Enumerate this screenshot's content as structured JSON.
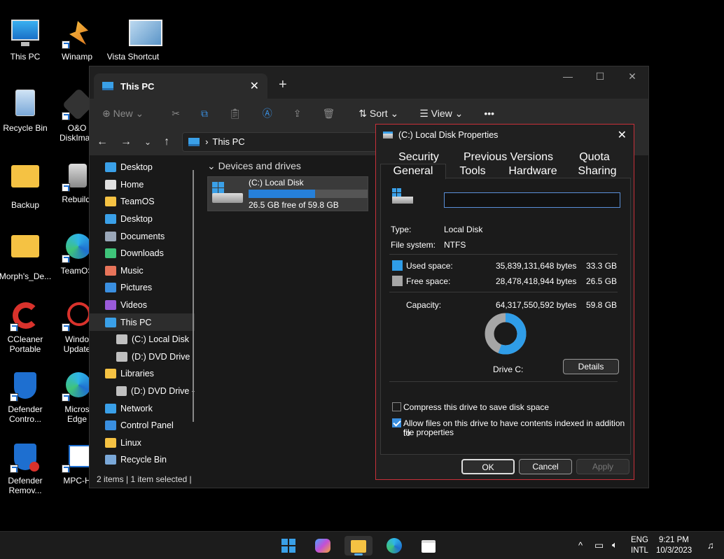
{
  "desktop": {
    "icons": [
      {
        "label": "This PC"
      },
      {
        "label": "Winamp"
      },
      {
        "label": "Vista Shortcut"
      },
      {
        "label": "Recycle Bin"
      },
      {
        "label": "O&O"
      },
      {
        "label": "DiskImag"
      },
      {
        "label": "Backup"
      },
      {
        "label": "Rebuildl"
      },
      {
        "label": "Morph's_De..."
      },
      {
        "label": "TeamOS"
      },
      {
        "label": "CCleaner"
      },
      {
        "label": "Portable"
      },
      {
        "label": "Windo"
      },
      {
        "label": "Update"
      },
      {
        "label": "Defender"
      },
      {
        "label": "Contro..."
      },
      {
        "label": "Micros"
      },
      {
        "label": "Edge"
      },
      {
        "label": "Defender"
      },
      {
        "label": "Remov..."
      },
      {
        "label": "MPC-H"
      }
    ]
  },
  "explorer": {
    "tab_title": "This PC",
    "tab_close": "✕",
    "new_tab": "+",
    "window_controls": {
      "minimize": "—",
      "maximize": "☐",
      "close": "✕"
    },
    "toolbar": {
      "new": "⊕  New ⌄",
      "sort": "⇅  Sort ⌄",
      "view": "☰  View ⌄",
      "more": "•••"
    },
    "nav": {
      "back": "←",
      "forward": "→",
      "recent": "⌄",
      "up": "↑"
    },
    "address": {
      "separator": "›",
      "path": "This PC"
    },
    "sidebar": [
      {
        "label": "Desktop",
        "color": "#3aa0e8"
      },
      {
        "label": "Home",
        "color": "#e0e0e0"
      },
      {
        "label": "TeamOS",
        "color": "#f5c243"
      },
      {
        "label": "Desktop",
        "color": "#3aa0e8"
      },
      {
        "label": "Documents",
        "color": "#9aa7b8"
      },
      {
        "label": "Downloads",
        "color": "#3fc47a"
      },
      {
        "label": "Music",
        "color": "#e8745a"
      },
      {
        "label": "Pictures",
        "color": "#3a8fe0"
      },
      {
        "label": "Videos",
        "color": "#9a5ad9"
      },
      {
        "label": "This PC",
        "color": "#3aa0e8"
      },
      {
        "label": "(C:) Local Disk",
        "color": "#c0c0c0"
      },
      {
        "label": "(D:) DVD Drive",
        "color": "#c0c0c0"
      },
      {
        "label": "Libraries",
        "color": "#f5c243"
      },
      {
        "label": "(D:) DVD Drive -",
        "color": "#c0c0c0"
      },
      {
        "label": "Network",
        "color": "#3aa0e8"
      },
      {
        "label": "Control Panel",
        "color": "#3a8fe0"
      },
      {
        "label": "Linux",
        "color": "#f5c243"
      },
      {
        "label": "Recycle Bin",
        "color": "#7aa8d8"
      }
    ],
    "section_title": "Devices and drives",
    "drive": {
      "name": "(C:) Local Disk",
      "free_text": "26.5 GB free of 59.8 GB",
      "used_fraction": 0.557
    },
    "status": "2 items  |  1 item selected  |"
  },
  "dialog": {
    "title": "(C:) Local Disk Properties",
    "close": "✕",
    "tabs_row1": [
      "Security",
      "Previous Versions",
      "Quota"
    ],
    "tabs_row2": [
      "General",
      "Tools",
      "Hardware",
      "Sharing"
    ],
    "name_value": "",
    "type_label": "Type:",
    "type_value": "Local Disk",
    "fs_label": "File system:",
    "fs_value": "NTFS",
    "used_label": "Used space:",
    "used_bytes": "35,839,131,648 bytes",
    "used_gb": "33.3 GB",
    "free_label": "Free space:",
    "free_bytes": "28,478,418,944 bytes",
    "free_gb": "26.5 GB",
    "capacity_label": "Capacity:",
    "capacity_bytes": "64,317,550,592 bytes",
    "capacity_gb": "59.8 GB",
    "drive_label": "Drive C:",
    "details_button": "Details",
    "compress_label": "Compress this drive to save disk space",
    "index_label_1": "Allow files on this drive to have contents indexed in addition to",
    "index_label_2": "file properties",
    "ok_button": "OK",
    "cancel_button": "Cancel",
    "apply_button": "Apply",
    "used_color": "#2f9de8",
    "free_color": "#a6a6a6"
  },
  "taskbar": {
    "tray": {
      "chevron": "^",
      "lang1": "ENG",
      "lang2": "INTL",
      "time": "9:21 PM",
      "date": "10/3/2023"
    }
  }
}
